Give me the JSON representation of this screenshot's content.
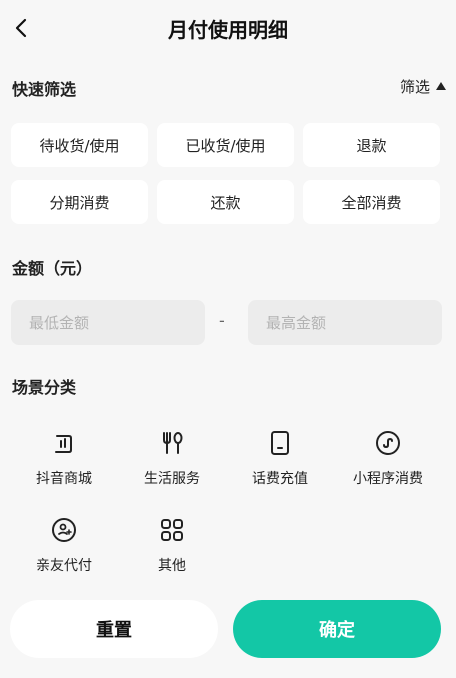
{
  "header": {
    "title": "月付使用明细",
    "back_icon": "chevron-left-icon"
  },
  "quick_filter": {
    "title": "快速筛选",
    "toggle_label": "筛选",
    "chips": [
      "待收货/使用",
      "已收货/使用",
      "退款",
      "分期消费",
      "还款",
      "全部消费"
    ]
  },
  "amount": {
    "title": "金额（元）",
    "min_placeholder": "最低金额",
    "max_placeholder": "最高金额",
    "separator": "-"
  },
  "scenes": {
    "title": "场景分类",
    "items": [
      {
        "label": "抖音商城",
        "icon": "shop-bag-icon"
      },
      {
        "label": "生活服务",
        "icon": "fork-spoon-icon"
      },
      {
        "label": "话费充值",
        "icon": "phone-icon"
      },
      {
        "label": "小程序消费",
        "icon": "mini-program-icon"
      },
      {
        "label": "亲友代付",
        "icon": "friend-pay-icon"
      },
      {
        "label": "其他",
        "icon": "grid-icon"
      }
    ]
  },
  "actions": {
    "reset": "重置",
    "confirm": "确定"
  },
  "colors": {
    "accent": "#13c7a6",
    "background": "#f7f7f7"
  }
}
